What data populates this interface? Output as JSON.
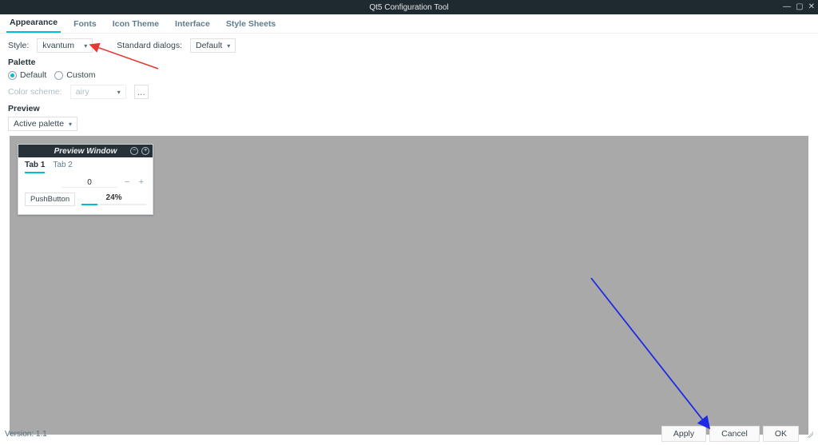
{
  "window": {
    "title": "Qt5 Configuration Tool"
  },
  "tabs": {
    "t0": "Appearance",
    "t1": "Fonts",
    "t2": "Icon Theme",
    "t3": "Interface",
    "t4": "Style Sheets"
  },
  "style_row": {
    "label": "Style:",
    "value": "kvantum",
    "dialogs_label": "Standard dialogs:",
    "dialogs_value": "Default"
  },
  "palette": {
    "title": "Palette",
    "default": "Default",
    "custom": "Custom",
    "color_scheme_label": "Color scheme:",
    "color_scheme_value": "airy",
    "browse": "..."
  },
  "preview": {
    "title": "Preview",
    "active_palette": "Active palette",
    "window_title": "Preview Window",
    "tab1": "Tab 1",
    "tab2": "Tab 2",
    "spin_value": "0",
    "pushbutton": "PushButton",
    "progress_pct": "24%"
  },
  "footer": {
    "version": "Version: 1.1",
    "apply": "Apply",
    "cancel": "Cancel",
    "ok": "OK"
  }
}
